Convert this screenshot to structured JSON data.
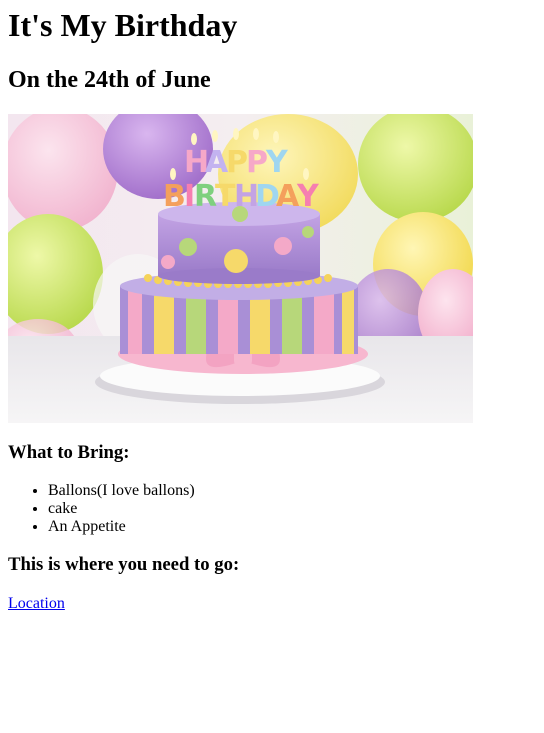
{
  "page": {
    "title": "It's My Birthday",
    "subtitle": "On the 24th of June",
    "image_label": "HAPPY BIRTHDAY",
    "bring_heading": "What to Bring:",
    "bring_items": [
      "Ballons(I love ballons)",
      "cake",
      "An Appetite"
    ],
    "go_heading": "This is where you need to go:",
    "location_link": "Location"
  },
  "colors": {
    "link": "#0000ee",
    "text": "#000000"
  }
}
